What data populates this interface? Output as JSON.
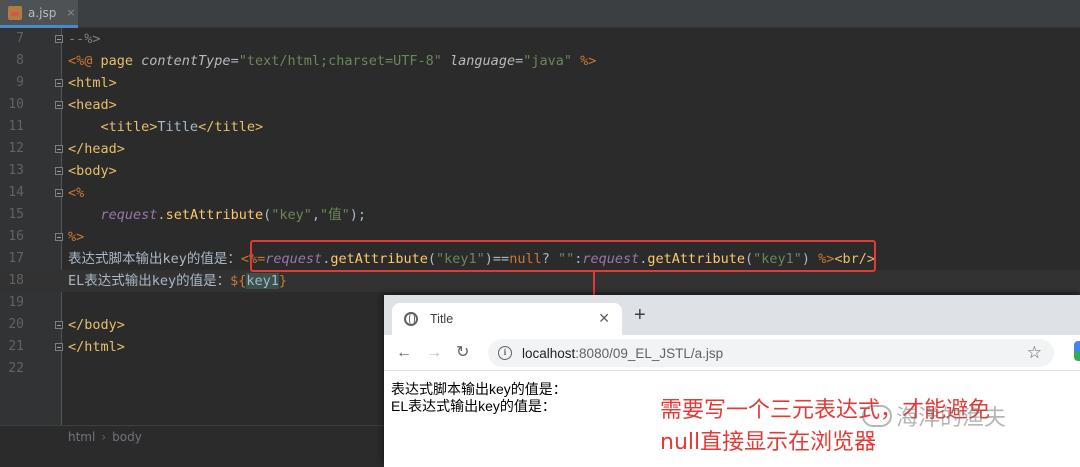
{
  "editor": {
    "tab": {
      "label": "a.jsp",
      "close": "×"
    },
    "lines": [
      {
        "num": "7",
        "html": "<span class=\"cmt\">--%></span>"
      },
      {
        "num": "8",
        "html": "<span class=\"jsp\">&lt;%@ </span><span class=\"kw\">page </span><span class=\"ital\" style=\"color:#bababa\">contentType</span><span class=\"plain\">=</span><span class=\"str\">\"text/html;charset=UTF-8\"</span><span class=\"plain\"> </span><span class=\"ital\" style=\"color:#bababa\">language</span><span class=\"plain\">=</span><span class=\"str\">\"java\"</span><span class=\"jsp\"> %></span>"
      },
      {
        "num": "9",
        "html": "<span class=\"tag\">&lt;html&gt;</span>"
      },
      {
        "num": "10",
        "html": "<span class=\"tag\">&lt;head&gt;</span>"
      },
      {
        "num": "11",
        "html": "    <span class=\"tag\">&lt;title&gt;</span><span class=\"plain\">Title</span><span class=\"tag\">&lt;/title&gt;</span>"
      },
      {
        "num": "12",
        "html": "<span class=\"tag\">&lt;/head&gt;</span>"
      },
      {
        "num": "13",
        "html": "<span class=\"tag\">&lt;body&gt;</span>"
      },
      {
        "num": "14",
        "html": "<span class=\"jsp\">&lt;%</span>"
      },
      {
        "num": "15",
        "html": "    <span class=\"ital\">request</span><span class=\"plain\">.</span><span class=\"meth\">setAttribute</span><span class=\"plain\">(</span><span class=\"str\">\"key\"</span><span class=\"plain\">,</span><span class=\"str\">\"值\"</span><span class=\"plain\">);</span>"
      },
      {
        "num": "16",
        "html": "<span class=\"jsp\">%></span>"
      },
      {
        "num": "17",
        "html": "<span class=\"plain\">表达式脚本输出key的值是：</span><span class=\"jsp\">&lt;%=</span><span class=\"ital\">request</span><span class=\"plain\">.</span><span class=\"meth\">getAttribute</span><span class=\"plain\">(</span><span class=\"str\">\"key1\"</span><span class=\"plain\">)==</span><span class=\"jsp\">null</span><span class=\"plain\">? </span><span class=\"str\">\"\"</span><span class=\"plain\">:</span><span class=\"ital\">request</span><span class=\"plain\">.</span><span class=\"meth\">getAttribute</span><span class=\"plain\">(</span><span class=\"str\">\"key1\"</span><span class=\"plain\">) </span><span class=\"jsp\">%></span><span class=\"tag\">&lt;br/&gt;</span>"
      },
      {
        "num": "18",
        "html": "<span class=\"plain\">EL表达式输出key的值是：</span><span class=\"jsp\">${</span><span class=\"elkey\">key1</span><span class=\"jsp\">}</span>"
      },
      {
        "num": "19",
        "html": ""
      },
      {
        "num": "20",
        "html": "<span class=\"tag\">&lt;/body&gt;</span>"
      },
      {
        "num": "21",
        "html": "<span class=\"tag\">&lt;/html&gt;</span>"
      },
      {
        "num": "22",
        "html": ""
      }
    ],
    "breadcrumb": [
      "html",
      "body"
    ]
  },
  "browser": {
    "tab_title": "Title",
    "tab_close": "✕",
    "new_tab": "+",
    "back": "←",
    "forward": "→",
    "reload": "↻",
    "url_host": "localhost",
    "url_rest": ":8080/09_EL_JSTL/a.jsp",
    "star": "☆",
    "content_line1": "表达式脚本输出key的值是：",
    "content_line2": "EL表达式输出key的值是："
  },
  "annotation": {
    "line1": "需要写一个三元表达式，才能避免",
    "line2": "null直接显示在浏览器"
  },
  "watermark": "海洋的渔夫",
  "colors": {
    "highlight": "#e53935",
    "editor_bg": "#2b2b2b"
  }
}
